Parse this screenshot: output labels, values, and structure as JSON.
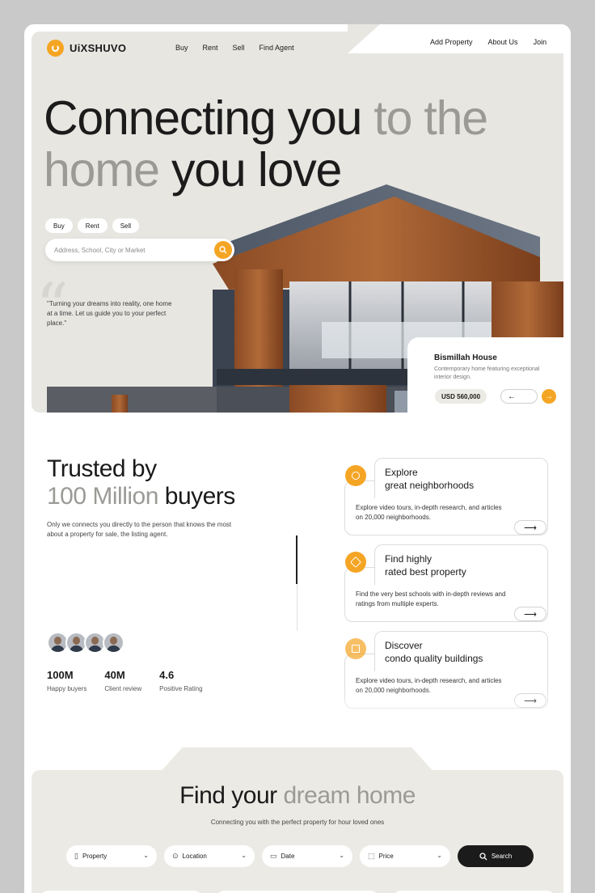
{
  "brand": {
    "name": "UiXSHUVO",
    "accent": "#f5a524"
  },
  "nav": {
    "left": [
      "Buy",
      "Rent",
      "Sell",
      "Find Agent"
    ],
    "right": [
      "Add Property",
      "About Us",
      "Join"
    ]
  },
  "hero": {
    "headline_line1_dark": "Connecting you",
    "headline_line1_muted": " to the",
    "headline_line2_muted": "home",
    "headline_line2_dark": " you love",
    "tabs": [
      "Buy",
      "Rent",
      "Sell"
    ],
    "search_placeholder": "Address, School, City or Market",
    "quote": "\"Turning your dreams into reality, one home at a time. Let us guide you to your perfect place.\"",
    "listing": {
      "name": "Bismillah House",
      "description": "Contemporary home featuring exceptional interior design.",
      "price": "USD 560,000"
    }
  },
  "trusted": {
    "title_line1": "Trusted by",
    "title_muted": "100 Million",
    "title_dark": " buyers",
    "description": "Only we connects you directly to the person that knows the most about a property for sale, the listing agent.",
    "stats": [
      {
        "value": "100M",
        "label": "Happy buyers"
      },
      {
        "value": "40M",
        "label": "Client review"
      },
      {
        "value": "4.6",
        "label": "Positive Rating"
      }
    ]
  },
  "features": [
    {
      "title_1": "Explore",
      "title_2": "great neighborhoods",
      "text": "Explore video tours, in-depth research, and articles on 20,000 neighborhoods.",
      "icon": "compass-icon"
    },
    {
      "title_1": "Find highly",
      "title_2": "rated best property",
      "text": "Find the very best schools with in-depth reviews and ratings from multiple experts.",
      "icon": "star-icon"
    },
    {
      "title_1": "Discover",
      "title_2": "condo quality buildings",
      "text": "Explore video tours, in-depth research, and articles on 20,000 neighborhoods.",
      "icon": "building-icon"
    }
  ],
  "dream": {
    "title_dark": "Find your",
    "title_muted": " dream home",
    "subtitle": "Connecting you with the perfect property for hour loved ones",
    "filters": [
      {
        "label": "Property",
        "icon": "building-icon"
      },
      {
        "label": "Location",
        "icon": "pin-icon"
      },
      {
        "label": "Date",
        "icon": "calendar-icon"
      },
      {
        "label": "Price",
        "icon": "tag-icon"
      }
    ],
    "search_label": "Search"
  }
}
